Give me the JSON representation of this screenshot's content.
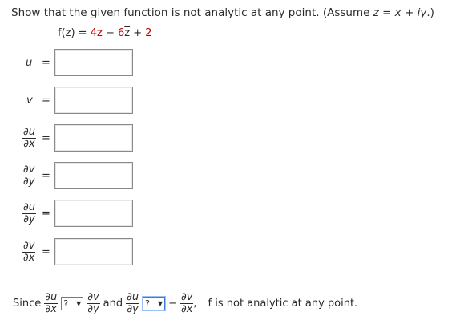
{
  "problem": {
    "prompt_lead": "Show that the given function is not analytic at any point. (Assume ",
    "assumption": "z = x + iy",
    "prompt_tail": ".)",
    "function_lhs": "f(z) = ",
    "coef_z": "4z",
    "minus": " − ",
    "coef_zbar_num": "6",
    "zbar": "z",
    "plus": " + ",
    "constant": "2"
  },
  "rows": [
    {
      "label": "u",
      "eq": "="
    },
    {
      "label": "v",
      "eq": "="
    },
    {
      "num": "∂u",
      "den": "∂x",
      "eq": "="
    },
    {
      "num": "∂v",
      "den": "∂y",
      "eq": "="
    },
    {
      "num": "∂u",
      "den": "∂y",
      "eq": "="
    },
    {
      "num": "∂v",
      "den": "∂x",
      "eq": "="
    }
  ],
  "conclusion": {
    "since": "Since",
    "f1_num": "∂u",
    "f1_den": "∂x",
    "select1": "?",
    "f2_num": "∂v",
    "f2_den": "∂y",
    "and": "and",
    "f3_num": "∂u",
    "f3_den": "∂y",
    "select2": "?",
    "neg": "−",
    "f4_num": "∂v",
    "f4_den": "∂x",
    "comma": ",",
    "end_text": "f is not analytic at any point.",
    "arrow_icon": "▼"
  }
}
